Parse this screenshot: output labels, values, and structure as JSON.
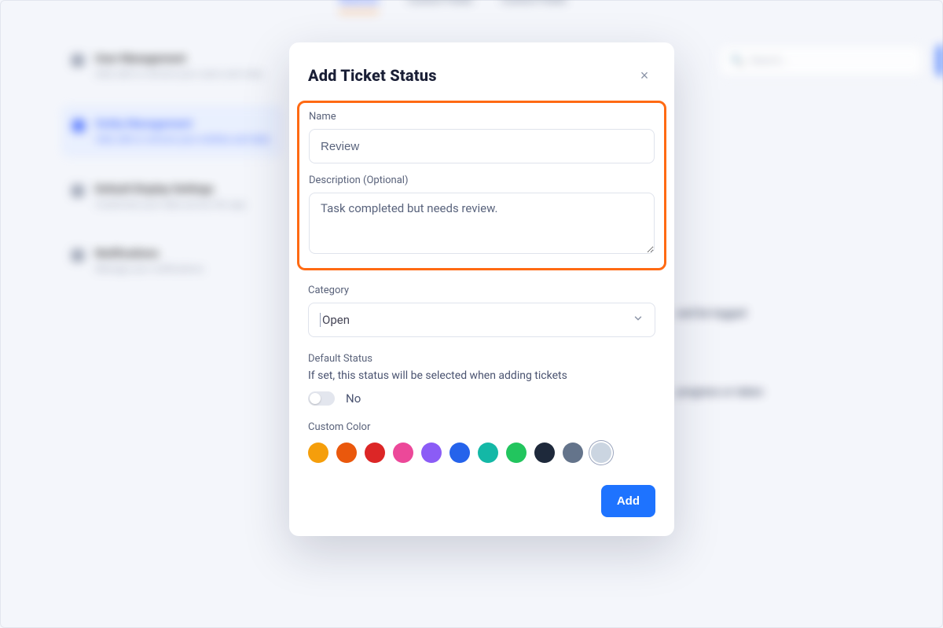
{
  "background": {
    "tabs": [
      "Statuses",
      "Custom Fields",
      "Custom Fields"
    ],
    "active_tab_index": 0,
    "search_placeholder": "Search...",
    "sidebar_items": [
      {
        "title": "User Management",
        "sub": "Add, edit or remove your users and roles"
      },
      {
        "title": "Entity Management",
        "sub": "Add, edit or remove your entities and data"
      },
      {
        "title": "Default Display Settings",
        "sub": "Customize your data across the app"
      },
      {
        "title": "Notifications",
        "sub": "Manage your notifications"
      }
    ],
    "row_text_1": "and be logged",
    "row_text_2": "progress or taken"
  },
  "modal": {
    "title": "Add Ticket Status",
    "close_label": "×",
    "name_label": "Name",
    "name_value": "Review",
    "description_label": "Description (Optional)",
    "description_value": "Task completed but needs review.",
    "category_label": "Category",
    "category_value": "Open",
    "default_status_label": "Default Status",
    "default_status_help": "If set, this status will be selected when adding tickets",
    "default_status_value_label": "No",
    "default_status_value": false,
    "custom_color_label": "Custom Color",
    "colors": [
      {
        "name": "orange",
        "hex": "#f59e0b",
        "selected": false
      },
      {
        "name": "vermilion",
        "hex": "#ea580c",
        "selected": false
      },
      {
        "name": "red",
        "hex": "#dc2626",
        "selected": false
      },
      {
        "name": "pink",
        "hex": "#ec4899",
        "selected": false
      },
      {
        "name": "purple",
        "hex": "#8b5cf6",
        "selected": false
      },
      {
        "name": "blue",
        "hex": "#2563eb",
        "selected": false
      },
      {
        "name": "teal",
        "hex": "#14b8a6",
        "selected": false
      },
      {
        "name": "green",
        "hex": "#22c55e",
        "selected": false
      },
      {
        "name": "navy",
        "hex": "#1e293b",
        "selected": false
      },
      {
        "name": "slate",
        "hex": "#64748b",
        "selected": false
      },
      {
        "name": "light-gray",
        "hex": "#cbd5e1",
        "selected": true
      }
    ],
    "add_button_label": "Add"
  }
}
